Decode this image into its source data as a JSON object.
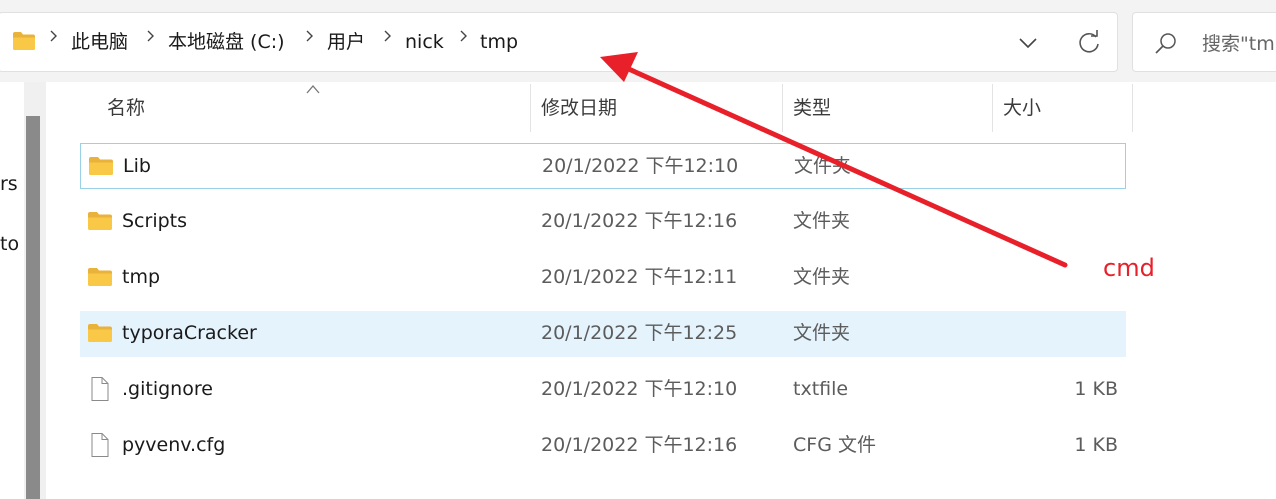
{
  "address_bar": {
    "breadcrumbs": [
      "此电脑",
      "本地磁盘 (C:)",
      "用户",
      "nick",
      "tmp"
    ]
  },
  "search": {
    "placeholder": "搜索\"tmp\""
  },
  "nav_pane": {
    "partial_items": [
      "rs",
      "to"
    ]
  },
  "columns": {
    "name": "名称",
    "date": "修改日期",
    "type": "类型",
    "size": "大小"
  },
  "rows": [
    {
      "name": "Lib",
      "date": "20/1/2022 下午12:10",
      "type": "文件夹",
      "size": "",
      "icon": "folder-icon",
      "state": "focused"
    },
    {
      "name": "Scripts",
      "date": "20/1/2022 下午12:16",
      "type": "文件夹",
      "size": "",
      "icon": "folder-icon",
      "state": ""
    },
    {
      "name": "tmp",
      "date": "20/1/2022 下午12:11",
      "type": "文件夹",
      "size": "",
      "icon": "folder-icon",
      "state": ""
    },
    {
      "name": "typoraCracker",
      "date": "20/1/2022 下午12:25",
      "type": "文件夹",
      "size": "",
      "icon": "folder-icon",
      "state": "selected"
    },
    {
      "name": ".gitignore",
      "date": "20/1/2022 下午12:10",
      "type": "txtfile",
      "size": "1 KB",
      "icon": "file-icon",
      "state": ""
    },
    {
      "name": "pyvenv.cfg",
      "date": "20/1/2022 下午12:16",
      "type": "CFG 文件",
      "size": "1 KB",
      "icon": "file-icon",
      "state": ""
    }
  ],
  "annotation": {
    "label": "cmd",
    "color": "#e8202a"
  },
  "colors": {
    "folder_yellow": "#f8c846",
    "selection_blue": "#e5f3fd",
    "focus_border": "#99d1e8"
  }
}
